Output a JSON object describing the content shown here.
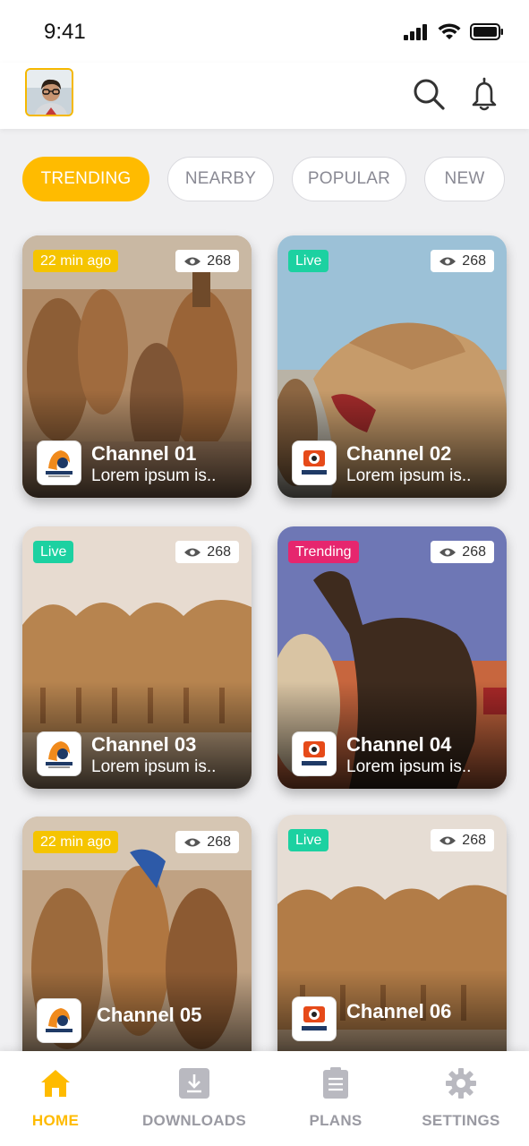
{
  "status": {
    "time": "9:41"
  },
  "header": {
    "avatar_icon": "user-avatar",
    "search_icon": "search-icon",
    "notification_icon": "bell-icon"
  },
  "tabs": [
    {
      "label": "TRENDING",
      "active": true
    },
    {
      "label": "NEARBY",
      "active": false
    },
    {
      "label": "POPULAR",
      "active": false
    },
    {
      "label": "NEW",
      "active": false
    }
  ],
  "channels": [
    {
      "title": "Channel 01",
      "subtitle": "Lorem ipsum is..",
      "badge": "22 min ago",
      "badge_color": "#f5c400",
      "views": "268",
      "logo": "HOTGAMES"
    },
    {
      "title": "Channel 02",
      "subtitle": "Lorem ipsum is..",
      "badge": "Live",
      "badge_color": "#1cd1a1",
      "views": "268",
      "logo": "SPORTTV"
    },
    {
      "title": "Channel 03",
      "subtitle": "Lorem ipsum is..",
      "badge": "Live",
      "badge_color": "#1cd1a1",
      "views": "268",
      "logo": "HOTGAMES"
    },
    {
      "title": "Channel 04",
      "subtitle": "Lorem ipsum is..",
      "badge": "Trending",
      "badge_color": "#e6266e",
      "views": "268",
      "logo": "SPORTTV"
    },
    {
      "title": "Channel 05",
      "subtitle": "",
      "badge": "22 min ago",
      "badge_color": "#f5c400",
      "views": "268",
      "logo": "HOTGAMES"
    },
    {
      "title": "Channel 06",
      "subtitle": "",
      "badge": "Live",
      "badge_color": "#1cd1a1",
      "views": "268",
      "logo": "SPORTTV"
    }
  ],
  "bottom_nav": [
    {
      "label": "HOME",
      "icon": "home-icon",
      "active": true
    },
    {
      "label": "DOWNLOADS",
      "icon": "download-icon",
      "active": false
    },
    {
      "label": "PLANS",
      "icon": "plans-icon",
      "active": false
    },
    {
      "label": "SETTINGS",
      "icon": "gear-icon",
      "active": false
    }
  ],
  "colors": {
    "accent": "#ffbb00",
    "live": "#1cd1a1",
    "trending": "#e6266e",
    "recent": "#f5c400"
  }
}
